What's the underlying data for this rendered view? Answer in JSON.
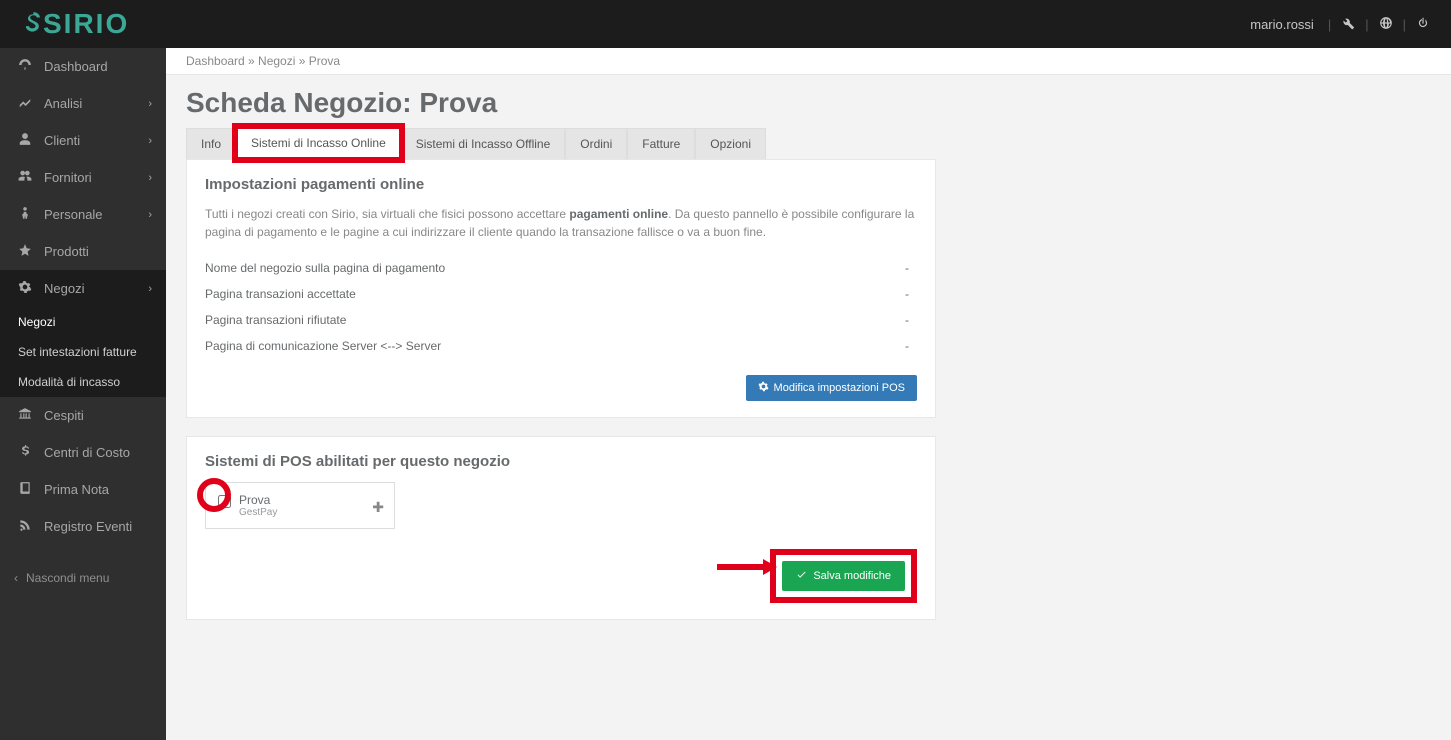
{
  "header": {
    "logo": "SIRIO",
    "username": "mario.rossi"
  },
  "sidebar": {
    "items": [
      {
        "icon": "dashboard",
        "label": "Dashboard",
        "chev": false
      },
      {
        "icon": "analytics",
        "label": "Analisi",
        "chev": true
      },
      {
        "icon": "user",
        "label": "Clienti",
        "chev": true
      },
      {
        "icon": "users",
        "label": "Fornitori",
        "chev": true
      },
      {
        "icon": "person",
        "label": "Personale",
        "chev": true
      },
      {
        "icon": "star",
        "label": "Prodotti",
        "chev": false
      },
      {
        "icon": "gear",
        "label": "Negozi",
        "chev": true,
        "expanded": true,
        "sub": [
          {
            "label": "Negozi",
            "active": true
          },
          {
            "label": "Set intestazioni fatture"
          },
          {
            "label": "Modalità di incasso"
          }
        ]
      },
      {
        "icon": "bank",
        "label": "Cespiti",
        "chev": false
      },
      {
        "icon": "dollar",
        "label": "Centri di Costo",
        "chev": false
      },
      {
        "icon": "book",
        "label": "Prima Nota",
        "chev": false
      },
      {
        "icon": "rss",
        "label": "Registro Eventi",
        "chev": false
      }
    ],
    "hide": "Nascondi menu"
  },
  "breadcrumb": "Dashboard » Negozi » Prova",
  "page_title": "Scheda Negozio: Prova",
  "tabs": [
    "Info",
    "Sistemi di Incasso Online",
    "Sistemi di Incasso Offline",
    "Ordini",
    "Fatture",
    "Opzioni"
  ],
  "panel1": {
    "title": "Impostazioni pagamenti online",
    "help_pre": "Tutti i negozi creati con Sirio, sia virtuali che fisici possono accettare ",
    "help_bold": "pagamenti online",
    "help_post": ". Da questo pannello è possibile configurare la pagina di pagamento e le pagine a cui indirizzare il cliente quando la transazione fallisce o va a buon fine.",
    "rows": [
      {
        "k": "Nome del negozio sulla pagina di pagamento",
        "v": "-"
      },
      {
        "k": "Pagina transazioni accettate",
        "v": "-"
      },
      {
        "k": "Pagina transazioni rifiutate",
        "v": "-"
      },
      {
        "k": "Pagina di comunicazione Server <--> Server",
        "v": "-"
      }
    ],
    "button": "Modifica impostazioni POS"
  },
  "panel2": {
    "title": "Sistemi di POS abilitati per questo negozio",
    "card": {
      "name": "Prova",
      "type": "GestPay"
    },
    "save": "Salva modifiche"
  }
}
